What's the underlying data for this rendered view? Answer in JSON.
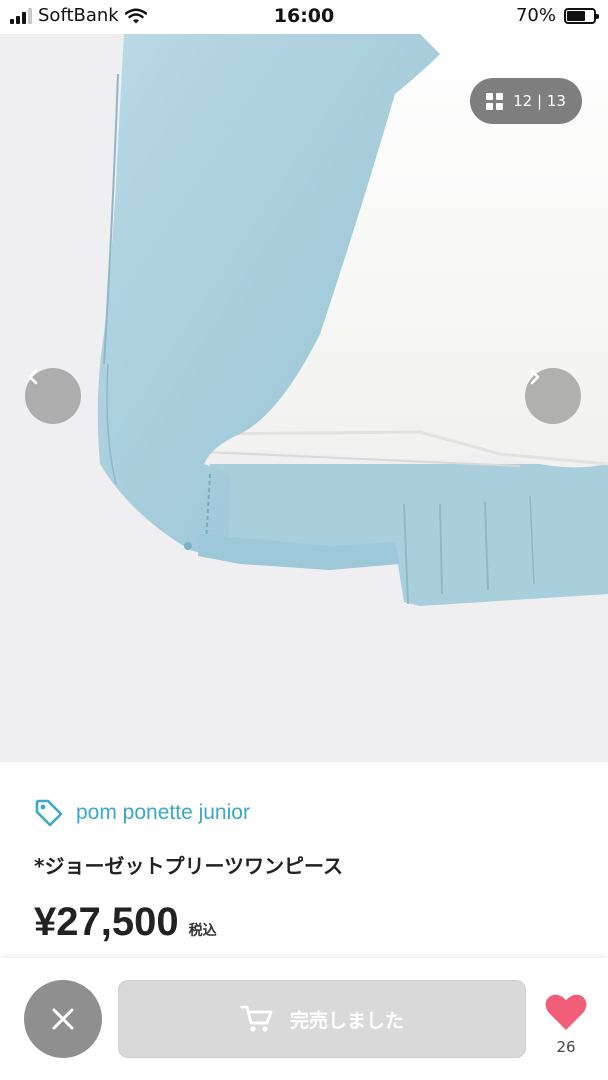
{
  "status_bar": {
    "carrier": "SoftBank",
    "time": "16:00",
    "battery_percent": "70%",
    "battery_level": 0.7
  },
  "gallery": {
    "counter": "12 | 13",
    "counter_icon": "grid-icon",
    "prev_icon": "chevron-left-icon",
    "next_icon": "chevron-right-icon"
  },
  "product": {
    "brand_icon": "tag-icon",
    "brand": "pom ponette junior",
    "title": "*ジョーゼットプリーツワンピース",
    "price": "¥27,500",
    "tax_label": "税込"
  },
  "actions": {
    "close_icon": "close-icon",
    "sold_out_icon": "cart-icon",
    "sold_out_label": "完売しました",
    "favorite_icon": "heart-icon",
    "favorite_count": "26"
  },
  "colors": {
    "accent": "#3aa8c9",
    "heart": "#f25d78",
    "fabric_blue": "#a9cfdc",
    "fabric_white": "#f8f8f6"
  }
}
